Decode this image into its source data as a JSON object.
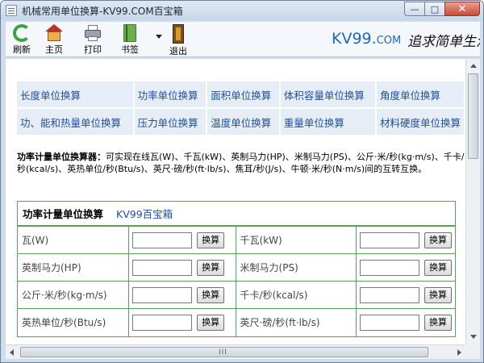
{
  "window": {
    "title": "机械常用单位换算-KV99.COM百宝箱",
    "min_glyph": "—",
    "max_glyph": "□",
    "close_glyph": "✕"
  },
  "toolbar": {
    "refresh": "刷新",
    "home": "主页",
    "print": "打印",
    "bookmark": "书签",
    "exit": "退出",
    "brand_main": "KV99.",
    "brand_suffix": "COM",
    "slogan": "追求简单生活"
  },
  "nav": {
    "row1": [
      "长度单位换算",
      "功率单位换算",
      "面积单位换算",
      "体积容量单位换算",
      "角度单位换算"
    ],
    "row2": [
      "功、能和热量单位换算",
      "压力单位换算",
      "温度单位换算",
      "重量单位换算",
      "材料硬度单位换算"
    ]
  },
  "description": {
    "lead": "功率计量单位换算器：",
    "body": "可实现在线瓦(W)、千瓦(kW)、英制马力(HP)、米制马力(PS)、公斤·米/秒(kg·m/s)、千卡/秒(kcal/s)、英热单位/秒(Btu/s)、英尺·磅/秒(ft·lb/s)、焦耳/秒(J/s)、牛顿·米/秒(N·m/s)间的互转互换。"
  },
  "calculator": {
    "title": "功率计量单位换算",
    "brand": "KV99百宝箱",
    "button_label": "换算",
    "rows": [
      [
        "瓦(W)",
        "千瓦(kW)"
      ],
      [
        "英制马力(HP)",
        "米制马力(PS)"
      ],
      [
        "公斤·米/秒(kg·m/s)",
        "千卡/秒(kcal/s)"
      ],
      [
        "英热单位/秒(Btu/s)",
        "英尺·磅/秒(ft·lb/s)"
      ]
    ]
  },
  "scrollbars": {
    "h_grip": "III"
  }
}
